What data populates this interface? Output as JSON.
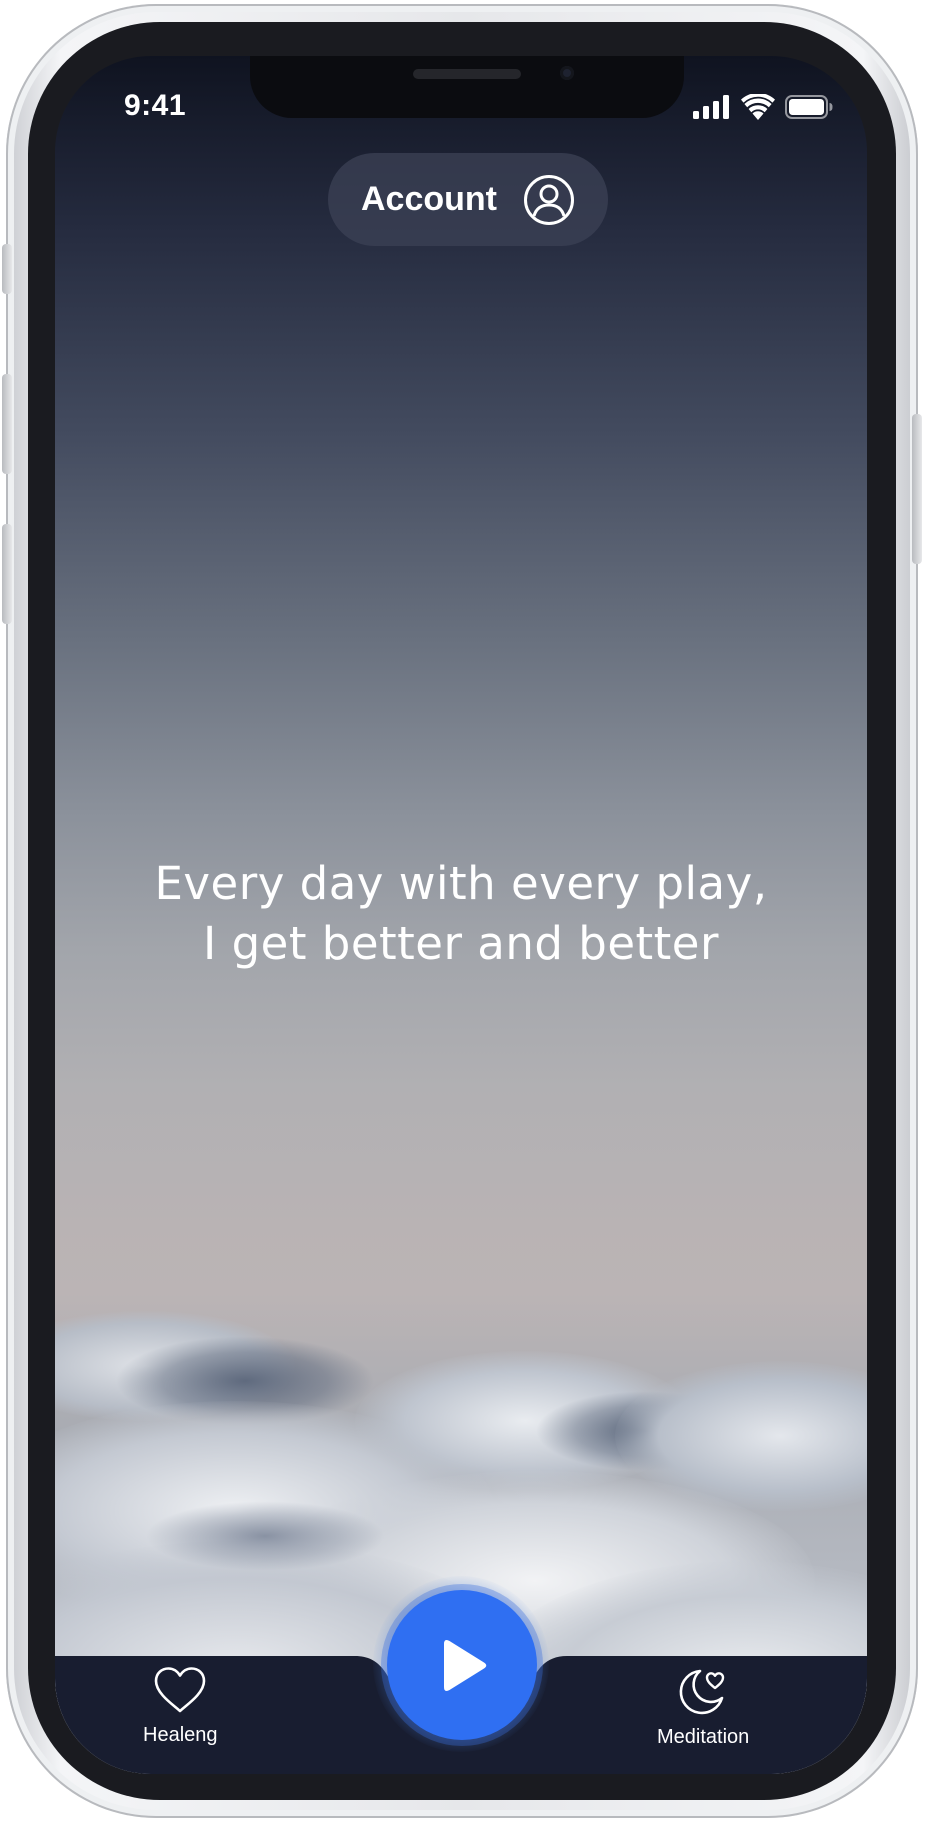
{
  "status_bar": {
    "time": "9:41"
  },
  "header": {
    "account_label": "Account",
    "account_icon": "user-circle-icon"
  },
  "main": {
    "quote_line1": "Every day with every play,",
    "quote_line2": "I get better and better"
  },
  "tabbar": {
    "left": {
      "label": "Healeng",
      "icon": "heart-icon"
    },
    "center": {
      "icon": "play-icon"
    },
    "right": {
      "label": "Meditation",
      "icon": "moon-heart-icon"
    }
  },
  "colors": {
    "accent": "#2f6ff2",
    "tabbar_background": "#181d30",
    "pill_background": "#3c4256"
  }
}
